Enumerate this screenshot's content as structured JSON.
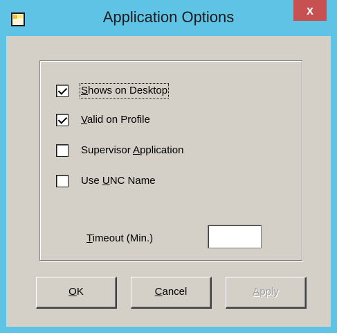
{
  "window": {
    "title": "Application Options",
    "close_label": "x"
  },
  "options": [
    {
      "label_prefix": "",
      "label_accel": "S",
      "label_suffix": "hows on Desktop",
      "checked": true,
      "focused": true
    },
    {
      "label_prefix": "",
      "label_accel": "V",
      "label_suffix": "alid on Profile",
      "checked": true,
      "focused": false
    },
    {
      "label_prefix": "Supervisor ",
      "label_accel": "A",
      "label_suffix": "pplication",
      "checked": false,
      "focused": false
    },
    {
      "label_prefix": "Use ",
      "label_accel": "U",
      "label_suffix": "NC Name",
      "checked": false,
      "focused": false
    }
  ],
  "timeout": {
    "label_accel": "T",
    "label_suffix": "imeout (Min.)",
    "value": ""
  },
  "buttons": {
    "ok": {
      "accel": "O",
      "rest": "K"
    },
    "cancel": {
      "accel": "C",
      "rest": "ancel"
    },
    "apply": {
      "accel": "A",
      "rest": "pply",
      "enabled": false
    }
  }
}
